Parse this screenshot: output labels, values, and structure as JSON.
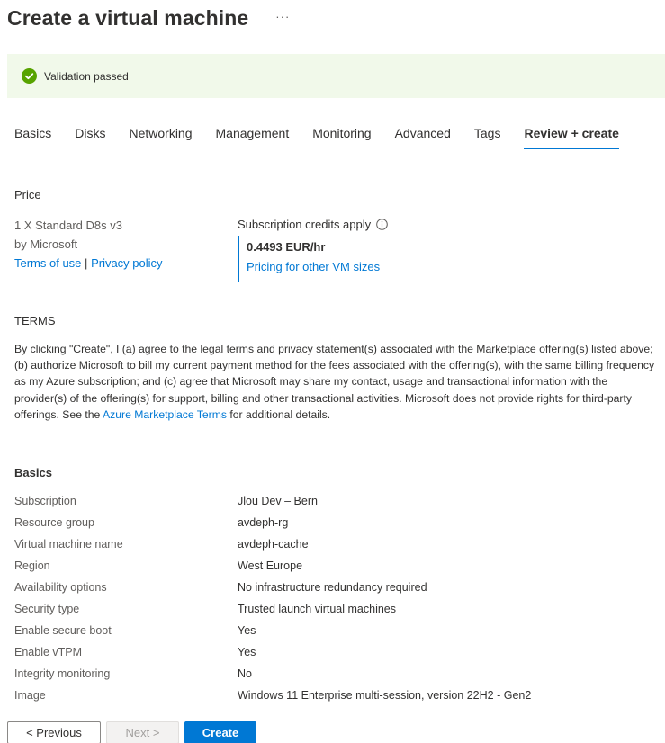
{
  "header": {
    "title": "Create a virtual machine",
    "more": "···"
  },
  "validation": {
    "text": "Validation passed",
    "color": "#57a300"
  },
  "tabs": [
    {
      "label": "Basics",
      "active": false
    },
    {
      "label": "Disks",
      "active": false
    },
    {
      "label": "Networking",
      "active": false
    },
    {
      "label": "Management",
      "active": false
    },
    {
      "label": "Monitoring",
      "active": false
    },
    {
      "label": "Advanced",
      "active": false
    },
    {
      "label": "Tags",
      "active": false
    },
    {
      "label": "Review + create",
      "active": true
    }
  ],
  "price": {
    "heading": "Price",
    "sku": "1 X Standard D8s v3",
    "publisher": "by Microsoft",
    "terms_link": "Terms of use",
    "separator": "|",
    "privacy_link": "Privacy policy",
    "credits": "Subscription credits apply",
    "amount": "0.4493 EUR/hr",
    "other_sizes_link": "Pricing for other VM sizes"
  },
  "terms": {
    "heading": "TERMS",
    "text_before": "By clicking \"Create\", I (a) agree to the legal terms and privacy statement(s) associated with the Marketplace offering(s) listed above; (b) authorize Microsoft to bill my current payment method for the fees associated with the offering(s), with the same billing frequency as my Azure subscription; and (c) agree that Microsoft may share my contact, usage and transactional information with the provider(s) of the offering(s) for support, billing and other transactional activities. Microsoft does not provide rights for third-party offerings. See the ",
    "link": "Azure Marketplace Terms",
    "text_after": " for additional details."
  },
  "basics": {
    "heading": "Basics",
    "rows": [
      {
        "key": "Subscription",
        "value": "Jlou Dev – Bern"
      },
      {
        "key": "Resource group",
        "value": "avdeph-rg"
      },
      {
        "key": "Virtual machine name",
        "value": "avdeph-cache"
      },
      {
        "key": "Region",
        "value": "West Europe"
      },
      {
        "key": "Availability options",
        "value": "No infrastructure redundancy required"
      },
      {
        "key": "Security type",
        "value": "Trusted launch virtual machines"
      },
      {
        "key": "Enable secure boot",
        "value": "Yes"
      },
      {
        "key": "Enable vTPM",
        "value": "Yes"
      },
      {
        "key": "Integrity monitoring",
        "value": "No"
      },
      {
        "key": "Image",
        "value": "Windows 11 Enterprise multi-session, version 22H2 - Gen2"
      }
    ]
  },
  "footer": {
    "previous": "< Previous",
    "next": "Next >",
    "create": "Create"
  },
  "colors": {
    "accent": "#0078d4",
    "success_bg": "#f1f9ea"
  }
}
